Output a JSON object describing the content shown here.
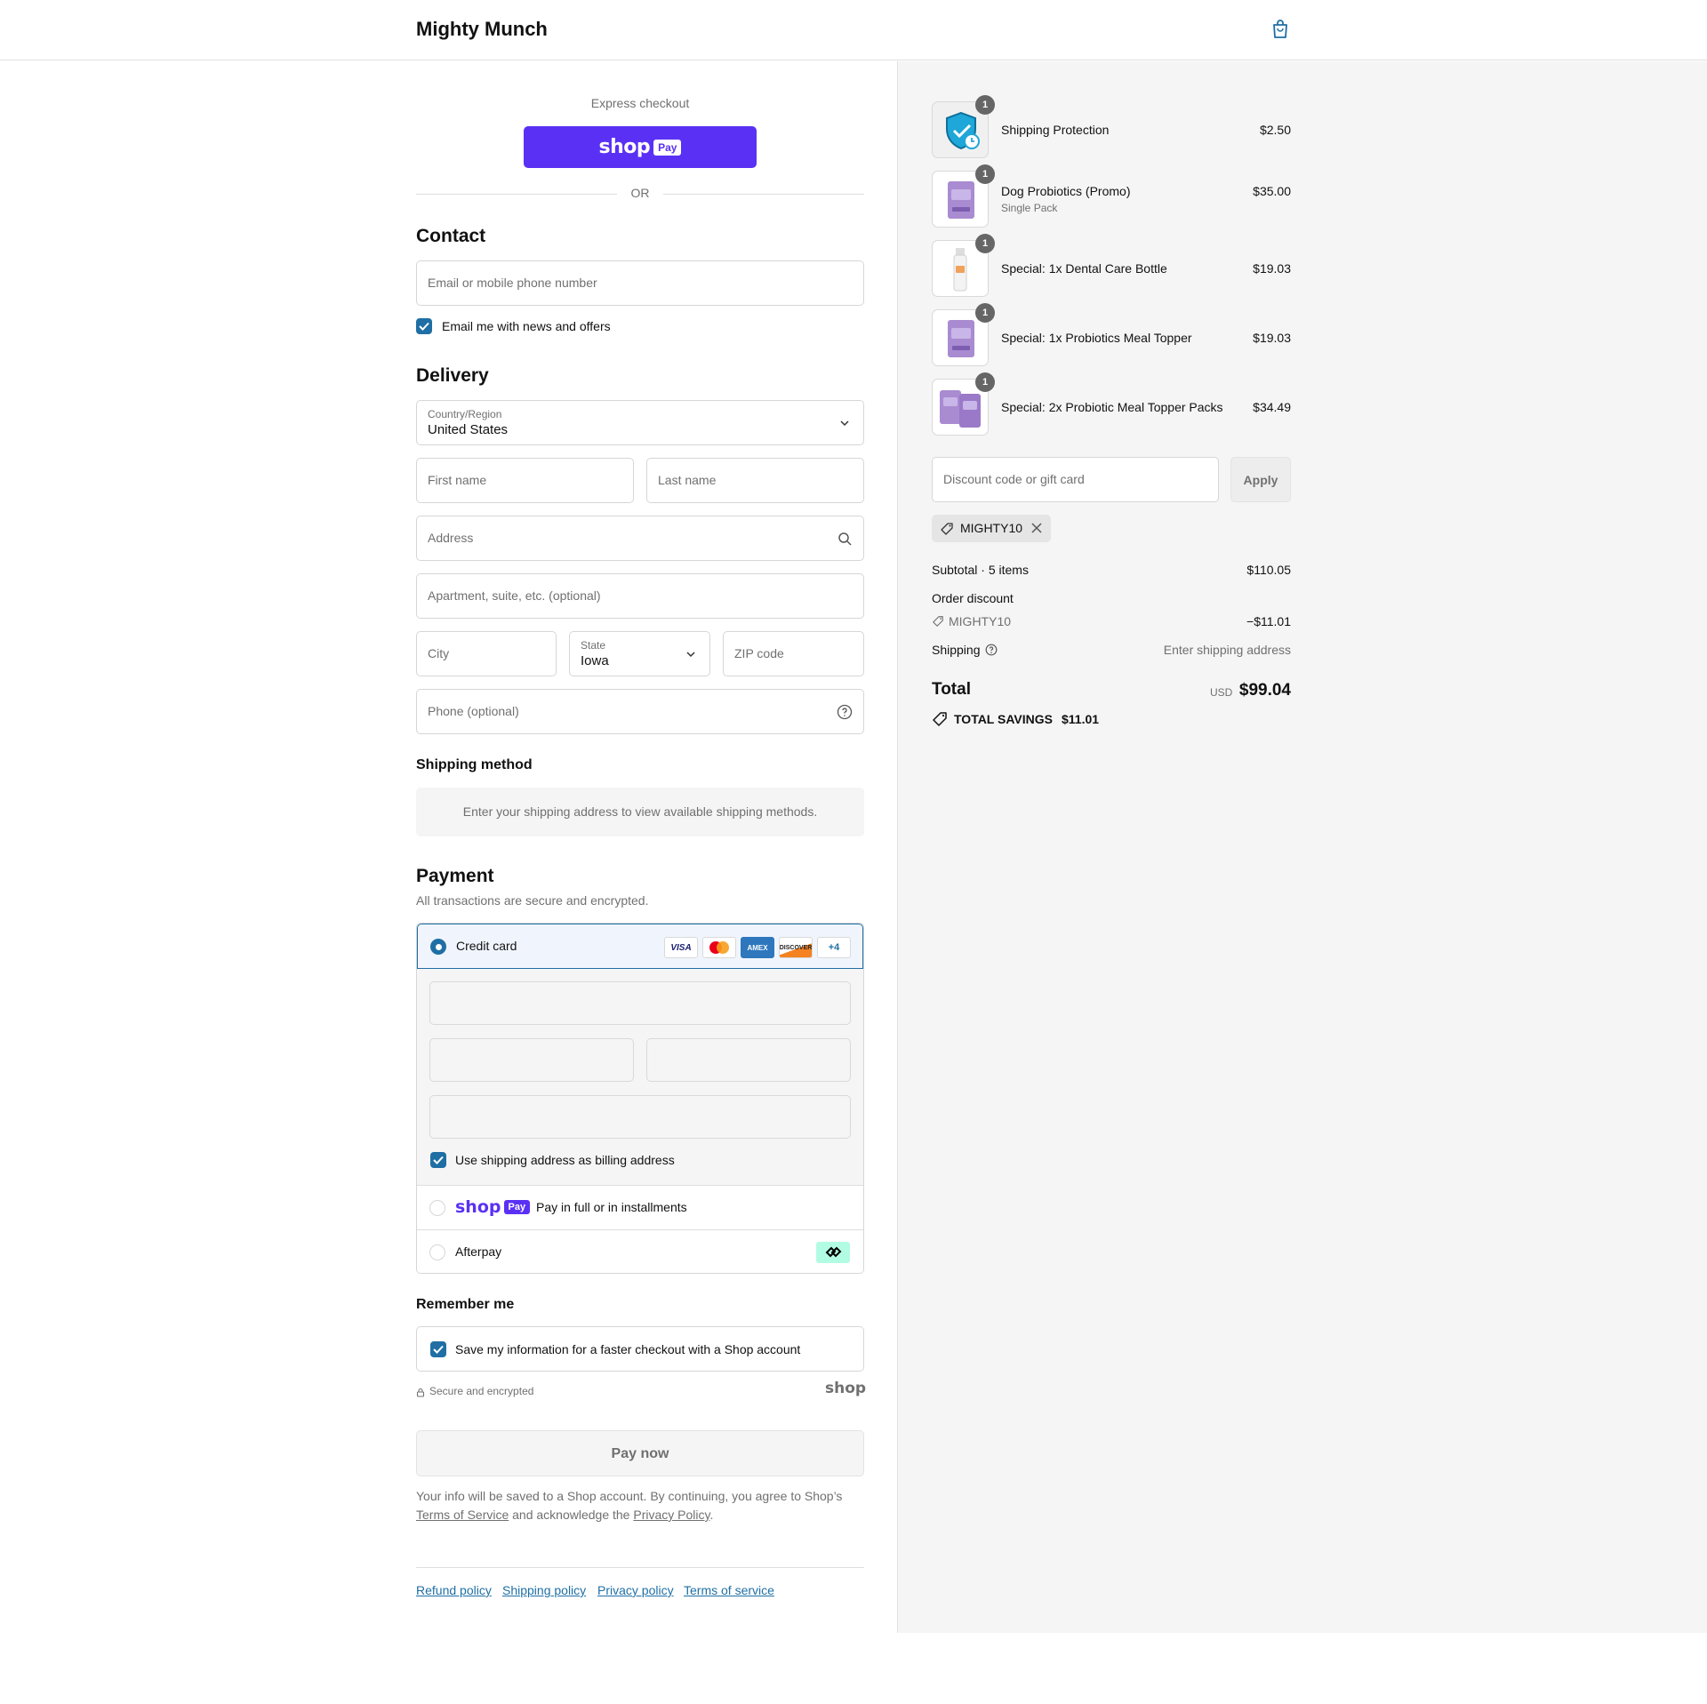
{
  "header": {
    "brand": "Mighty Munch",
    "cart_icon": "shopping-bag-icon"
  },
  "express": {
    "label": "Express checkout",
    "shop_word": "shop",
    "shop_pay": "Pay",
    "or": "OR"
  },
  "contact": {
    "title": "Contact",
    "email_placeholder": "Email or mobile phone number",
    "news_label": "Email me with news and offers",
    "news_checked": true
  },
  "delivery": {
    "title": "Delivery",
    "country_label": "Country/Region",
    "country_value": "United States",
    "first_name_placeholder": "First name",
    "last_name_placeholder": "Last name",
    "address_placeholder": "Address",
    "apartment_placeholder": "Apartment, suite, etc. (optional)",
    "city_placeholder": "City",
    "state_label": "State",
    "state_value": "Iowa",
    "zip_placeholder": "ZIP code",
    "phone_placeholder": "Phone (optional)"
  },
  "shipping_method": {
    "title": "Shipping method",
    "note": "Enter your shipping address to view available shipping methods."
  },
  "payment": {
    "title": "Payment",
    "subtitle": "All transactions are secure and encrypted.",
    "credit_card_label": "Credit card",
    "card_logos": [
      "VISA",
      "AMEX",
      "DISCOVER"
    ],
    "more_cards": "+4",
    "billing_label": "Use shipping address as billing address",
    "shop_pay_word": "shop",
    "shop_pay_badge": "Pay",
    "shop_pay_label": "Pay in full or in installments",
    "afterpay_label": "Afterpay"
  },
  "remember": {
    "title": "Remember me",
    "save_label": "Save my information for a faster checkout with a Shop account",
    "secure_text": "Secure and encrypted",
    "shop_logo": "shop"
  },
  "pay_now": "Pay now",
  "legal": {
    "text1": "Your info will be saved to a Shop account. By continuing, you agree to Shop’s",
    "tos": "Terms of Service",
    "text2": "and acknowledge the",
    "privacy": "Privacy Policy",
    "period": "."
  },
  "footer": {
    "links": [
      "Refund policy",
      "Shipping policy",
      "Privacy policy",
      "Terms of service"
    ]
  },
  "order": {
    "items": [
      {
        "name": "Shipping Protection",
        "variant": "",
        "price": "$2.50",
        "qty": "1"
      },
      {
        "name": "Dog Probiotics (Promo)",
        "variant": "Single Pack",
        "price": "$35.00",
        "qty": "1"
      },
      {
        "name": "Special: 1x Dental Care Bottle",
        "variant": "",
        "price": "$19.03",
        "qty": "1"
      },
      {
        "name": "Special: 1x Probiotics Meal Topper",
        "variant": "",
        "price": "$19.03",
        "qty": "1"
      },
      {
        "name": "Special: 2x Probiotic Meal Topper Packs",
        "variant": "",
        "price": "$34.49",
        "qty": "1"
      }
    ],
    "discount_placeholder": "Discount code or gift card",
    "apply": "Apply",
    "applied_code": "MIGHTY10",
    "subtotal_label": "Subtotal · 5 items",
    "subtotal_value": "$110.05",
    "order_discount_label": "Order discount",
    "discount_code": "MIGHTY10",
    "discount_value": "−$11.01",
    "shipping_label": "Shipping",
    "shipping_value": "Enter shipping address",
    "total_label": "Total",
    "currency": "USD",
    "total_value": "$99.04",
    "savings_label": "TOTAL SAVINGS",
    "savings_value": "$11.01"
  },
  "colors": {
    "accent": "#1f6fa5",
    "shop_pay": "#5a31f4",
    "afterpay": "#b2fce4"
  }
}
